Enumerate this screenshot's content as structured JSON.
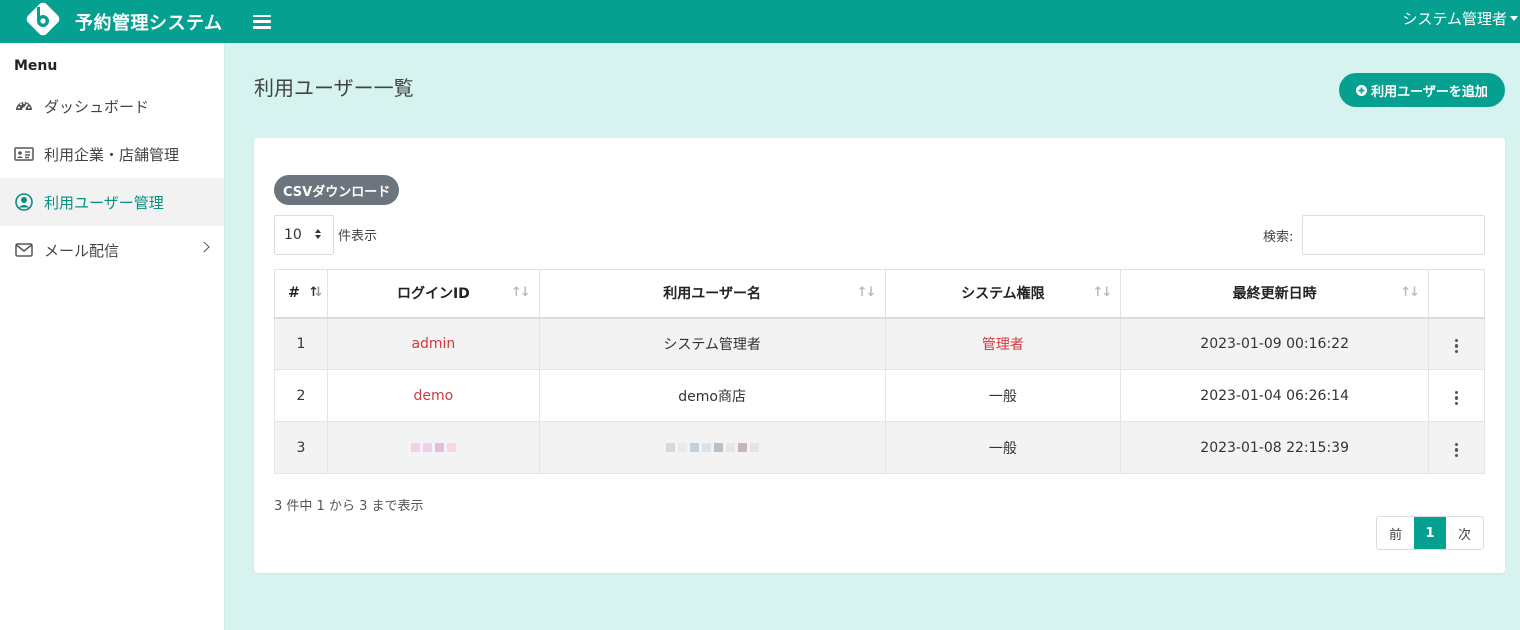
{
  "app": {
    "title": "予約管理システム",
    "user_menu": "システム管理者",
    "brand_color": "#06a090"
  },
  "sidebar": {
    "heading": "Menu",
    "items": [
      {
        "label": "ダッシュボード",
        "icon": "dashboard-icon",
        "active": false
      },
      {
        "label": "利用企業・店舗管理",
        "icon": "id-card-icon",
        "active": false
      },
      {
        "label": "利用ユーザー管理",
        "icon": "user-circle-icon",
        "active": true
      },
      {
        "label": "メール配信",
        "icon": "envelope-icon",
        "active": false,
        "has_submenu": true
      }
    ]
  },
  "main": {
    "title": "利用ユーザー一覧",
    "add_button": "利用ユーザーを追加",
    "csv_button": "CSVダウンロード",
    "page_length": "10",
    "page_length_label": "件表示",
    "search_label": "検索:",
    "search_value": "",
    "table": {
      "columns": [
        "#",
        "ログインID",
        "利用ユーザー名",
        "システム権限",
        "最終更新日時",
        ""
      ],
      "rows": [
        {
          "no": "1",
          "login_id": "admin",
          "name": "システム管理者",
          "role": "管理者",
          "updated": "2023-01-09 00:16:22"
        },
        {
          "no": "2",
          "login_id": "demo",
          "name": "demo商店",
          "role": "一般",
          "updated": "2023-01-04 06:26:14"
        },
        {
          "no": "3",
          "login_id": "",
          "name": "",
          "role": "一般",
          "updated": "2023-01-08 22:15:39"
        }
      ]
    },
    "info": "3 件中 1 から 3 まで表示",
    "pagination": {
      "prev": "前",
      "current": "1",
      "next": "次"
    }
  }
}
